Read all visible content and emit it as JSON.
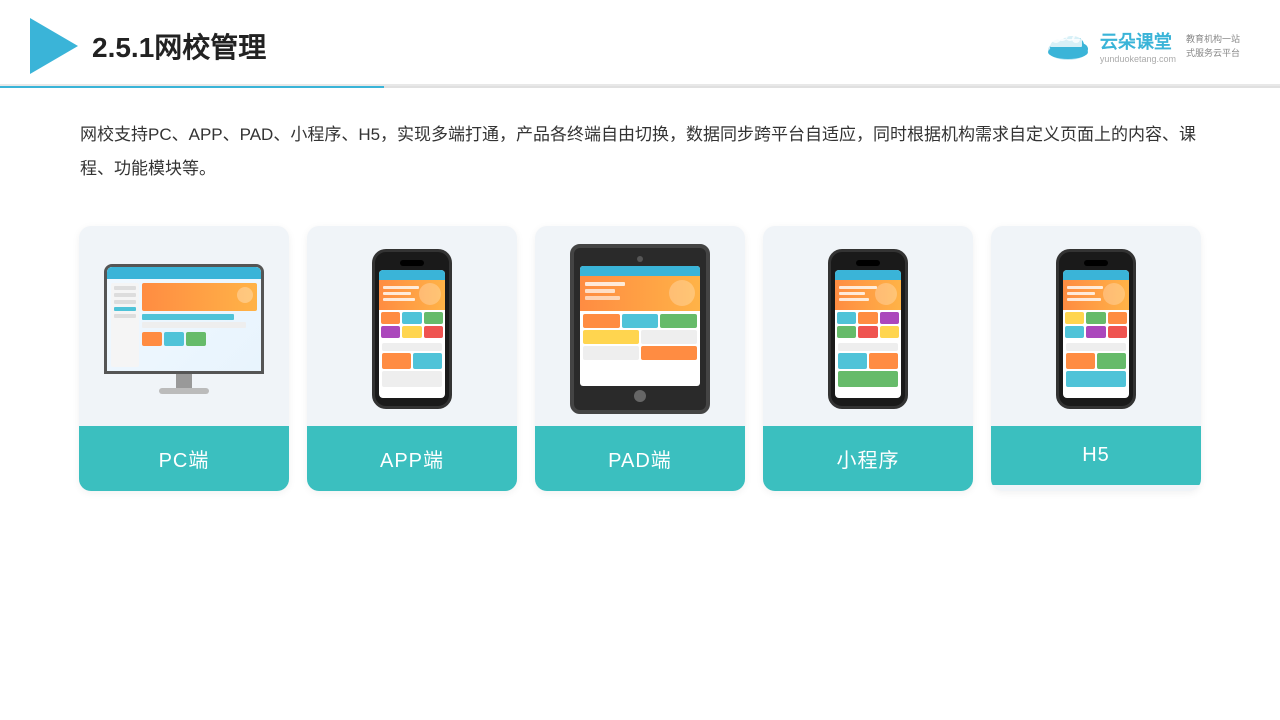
{
  "header": {
    "title": "2.5.1网校管理",
    "brand_name": "云朵课堂",
    "brand_url": "yunduoketang.com",
    "brand_tagline1": "教育机构一站",
    "brand_tagline2": "式服务云平台"
  },
  "description": {
    "text": "网校支持PC、APP、PAD、小程序、H5，实现多端打通，产品各终端自由切换，数据同步跨平台自适应，同时根据机构需求自定义页面上的内容、课程、功能模块等。"
  },
  "cards": [
    {
      "label": "PC端",
      "type": "pc"
    },
    {
      "label": "APP端",
      "type": "phone"
    },
    {
      "label": "PAD端",
      "type": "tablet"
    },
    {
      "label": "小程序",
      "type": "phone"
    },
    {
      "label": "H5",
      "type": "phone"
    }
  ]
}
